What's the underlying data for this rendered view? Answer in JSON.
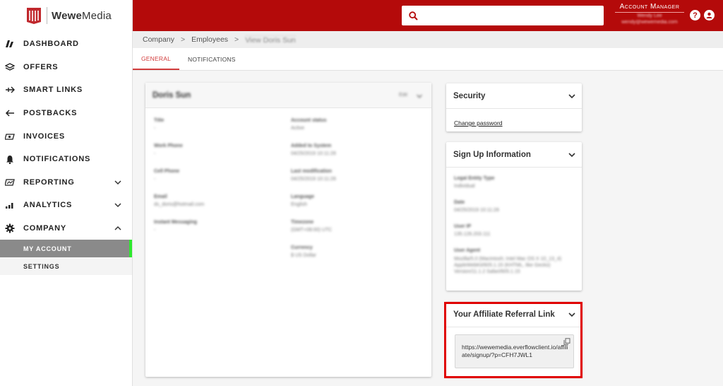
{
  "brand": {
    "name_bold": "Wewe",
    "name_rest": "Media",
    "color": "#b40a0a"
  },
  "sidebar": {
    "items": [
      {
        "label": "DASHBOARD",
        "icon": "dashboard-icon"
      },
      {
        "label": "OFFERS",
        "icon": "offers-icon"
      },
      {
        "label": "SMART LINKS",
        "icon": "smart-links-icon"
      },
      {
        "label": "POSTBACKS",
        "icon": "postbacks-icon"
      },
      {
        "label": "INVOICES",
        "icon": "invoices-icon"
      },
      {
        "label": "NOTIFICATIONS",
        "icon": "bell-icon"
      },
      {
        "label": "REPORTING",
        "icon": "reporting-icon"
      },
      {
        "label": "ANALYTICS",
        "icon": "analytics-icon"
      },
      {
        "label": "COMPANY",
        "icon": "gear-icon"
      }
    ],
    "sub_items": [
      {
        "label": "MY ACCOUNT",
        "active": true
      },
      {
        "label": "SETTINGS",
        "active": false
      }
    ],
    "active_indicator_color": "#2ee82e"
  },
  "header": {
    "search": {
      "placeholder": "",
      "value": ""
    },
    "account_manager_label": "Account Manager",
    "account_manager_name": "Wendy Lee",
    "account_manager_email": "wendy@wewemedia.com"
  },
  "breadcrumb": {
    "items": [
      "Company",
      "Employees"
    ],
    "current": "View Doris Sun"
  },
  "tabs": [
    {
      "label": "GENERAL",
      "active": true
    },
    {
      "label": "NOTIFICATIONS",
      "active": false
    }
  ],
  "profile": {
    "name": "Doris Sun",
    "edit_label": "Edit",
    "left_fields": [
      {
        "label": "Title",
        "value": "-"
      },
      {
        "label": "Work Phone",
        "value": "-"
      },
      {
        "label": "Cell Phone",
        "value": "-"
      },
      {
        "label": "Email",
        "value": "ds_doris@hotmail.com"
      },
      {
        "label": "Instant Messaging",
        "value": "-"
      }
    ],
    "right_fields": [
      {
        "label": "Account status",
        "value": "Active"
      },
      {
        "label": "Added to System",
        "value": "04/25/2019 10:11:28"
      },
      {
        "label": "Last modification",
        "value": "04/25/2019 10:11:28"
      },
      {
        "label": "Language",
        "value": "English"
      },
      {
        "label": "Timezone",
        "value": "(GMT+08:00) UTC"
      },
      {
        "label": "Currency",
        "value": "$ US Dollar"
      }
    ]
  },
  "security": {
    "title": "Security",
    "change_password": "Change password"
  },
  "signup": {
    "title": "Sign Up Information",
    "fields": [
      {
        "label": "Legal Entity Type",
        "value": "Individual"
      },
      {
        "label": "Date",
        "value": "04/25/2019 10:11:28"
      },
      {
        "label": "User IP",
        "value": "135.126.203.111"
      },
      {
        "label": "User Agent",
        "value": "Mozilla/5.0 (Macintosh; Intel Mac OS X 10_13_4) AppleWebKit/605.1.15 (KHTML, like Gecko) Version/11.1.2 Safari/605.1.15"
      }
    ]
  },
  "referral": {
    "title": "Your Affiliate Referral Link",
    "url": "https://wewemedia.everflowclient.io/affiliate/signup/?p=CFH7JWL1",
    "highlight_color": "#e00000"
  }
}
